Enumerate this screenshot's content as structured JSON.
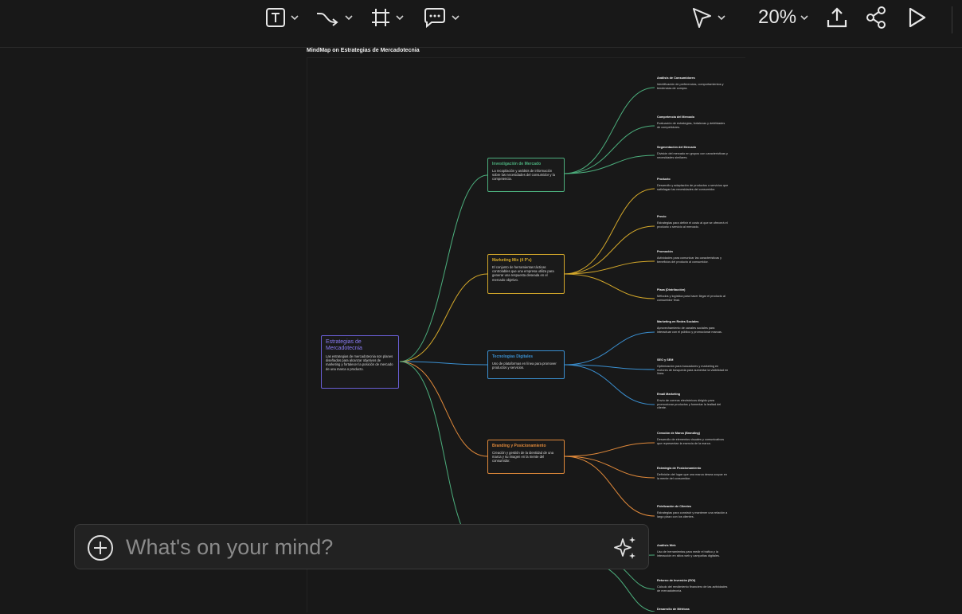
{
  "toolbar": {
    "tools": [
      {
        "icon": "text-tool-icon"
      },
      {
        "icon": "connector-tool-icon"
      },
      {
        "icon": "frame-tool-icon"
      },
      {
        "icon": "comment-tool-icon"
      }
    ],
    "pointer_icon": "pointer-icon",
    "zoom_label": "20%",
    "actions": [
      "upload-icon",
      "share-icon",
      "play-icon"
    ]
  },
  "board": {
    "title": "MindMap on Estrategias de Mercadotecnia"
  },
  "mindmap": {
    "root": {
      "title": "Estrategias de Mercadotecnia",
      "desc": "Las estrategias de mercadotecnia son planes diseñados para alcanzar objetivos de marketing y fortalecer la posición de mercado de una marca o producto.",
      "color": "#8b7cf6"
    },
    "branches": [
      {
        "title": "Investigación de Mercado",
        "desc": "La recopilación y análisis de información sobre las necesidades del consumidor y la competencia.",
        "color": "#4caf7d",
        "children": [
          {
            "title": "Análisis de Consumidores",
            "desc": "Identificación de preferencias, comportamientos y tendencias de compra."
          },
          {
            "title": "Competencia del Mercado",
            "desc": "Evaluación de estrategias, fortalezas y debilidades de competidores."
          },
          {
            "title": "Segmentación del Mercado",
            "desc": "División del mercado en grupos con características y necesidades similares."
          }
        ]
      },
      {
        "title": "Marketing Mix (4 P's)",
        "desc": "El conjunto de herramientas tácticas controlables que una empresa utiliza para generar una respuesta deseada en el mercado objetivo.",
        "color": "#d4a82a",
        "children": [
          {
            "title": "Producto",
            "desc": "Desarrollo y adaptación de productos o servicios que satisfagan las necesidades del consumidor."
          },
          {
            "title": "Precio",
            "desc": "Estrategias para definir el costo al que se ofrecerá el producto o servicio al mercado."
          },
          {
            "title": "Promoción",
            "desc": "Actividades para comunicar las características y beneficios del producto al consumidor."
          },
          {
            "title": "Plaza (Distribución)",
            "desc": "Métodos y logística para hacer llegar el producto al consumidor final."
          }
        ]
      },
      {
        "title": "Tecnologías Digitales",
        "desc": "Uso de plataformas en línea para promover productos y servicios.",
        "color": "#3a8fd0",
        "children": [
          {
            "title": "Marketing en Redes Sociales",
            "desc": "Aprovechamiento de canales sociales para interactuar con el público y promocionar marcas."
          },
          {
            "title": "SEO y SEM",
            "desc": "Optimización para buscadores y marketing en motores de búsqueda para aumentar la visibilidad en línea."
          },
          {
            "title": "Email Marketing",
            "desc": "Envío de correos electrónicos dirigido para promocionar productos y fomentar la lealtad del cliente."
          }
        ]
      },
      {
        "title": "Branding y Posicionamiento",
        "desc": "Creación y gestión de la identidad de una marca y su imagen en la mente del consumidor.",
        "color": "#e0893a",
        "children": [
          {
            "title": "Creación de Marca (Branding)",
            "desc": "Desarrollo de elementos visuales y comunicativos que representan la esencia de la marca."
          },
          {
            "title": "Estrategia de Posicionamiento",
            "desc": "Definición del lugar que una marca desea ocupar en la mente del consumidor."
          },
          {
            "title": "Fidelización de Clientes",
            "desc": "Estrategias para construir y mantener una relación a largo plazo con los clientes."
          }
        ]
      },
      {
        "color": "#4caf7d",
        "children": [
          {
            "title": "Análisis Web",
            "desc": "Uso de herramientas para medir el tráfico y la interacción en sitios web y campañas digitales."
          },
          {
            "title": "Retorno de Inversión (ROI)",
            "desc": "Cálculo del rendimiento financiero de las actividades de mercadotecnia."
          },
          {
            "title": "Desarrollo de Métricas",
            "desc": ""
          }
        ]
      }
    ]
  },
  "chat": {
    "placeholder": "What's on your mind?"
  }
}
